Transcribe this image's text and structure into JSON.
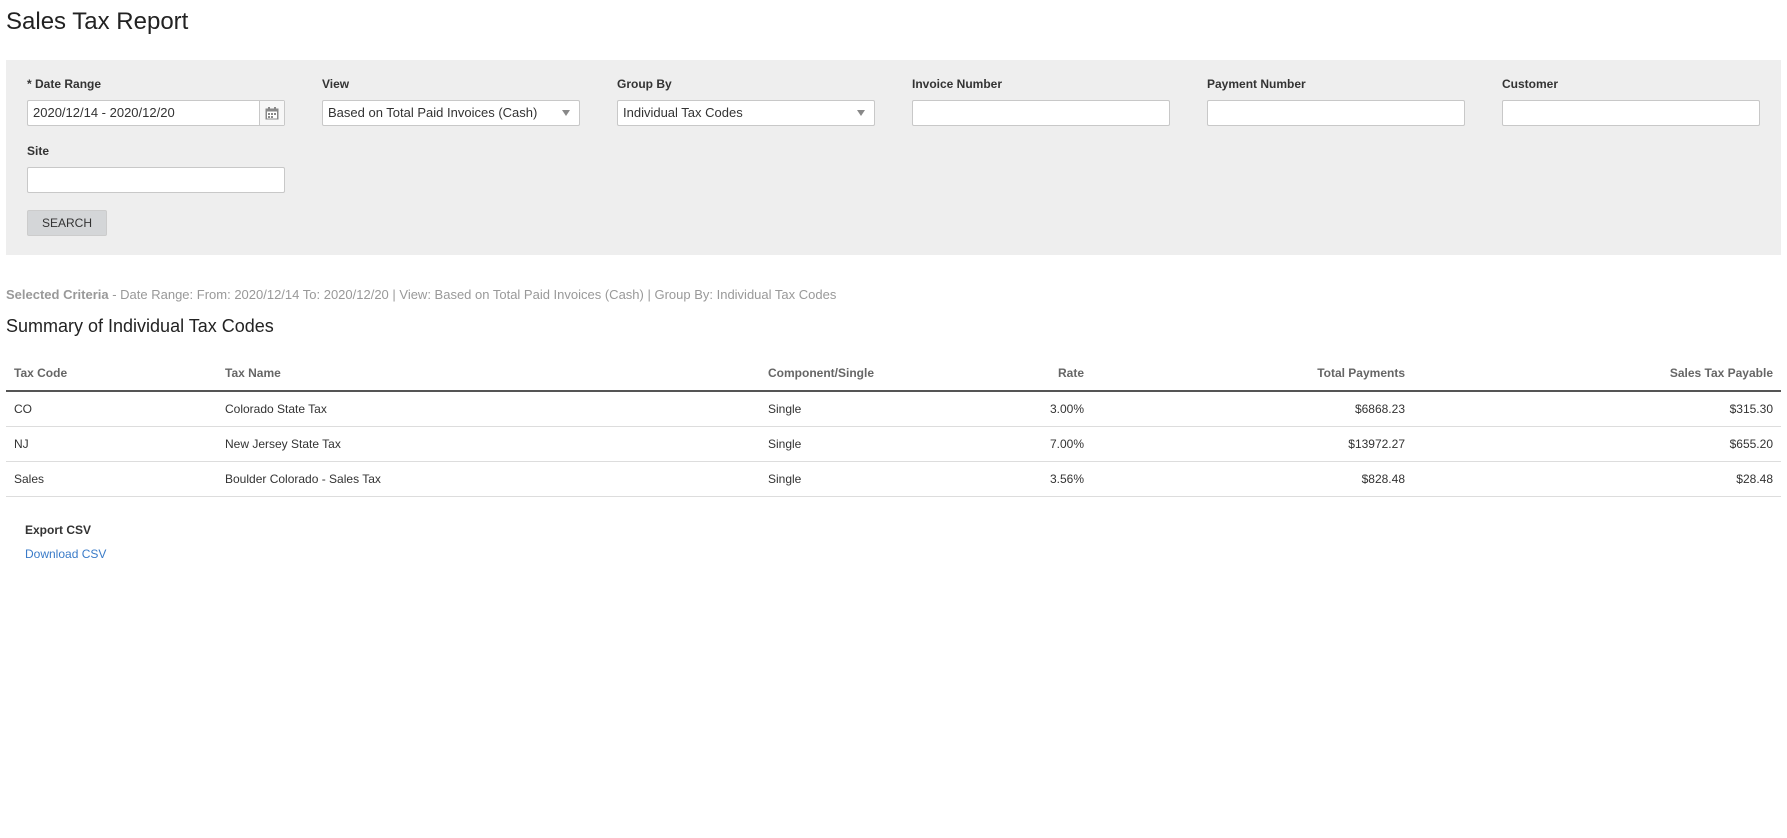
{
  "header": {
    "title": "Sales Tax Report"
  },
  "filters": {
    "date_range": {
      "label": "* Date Range",
      "value": "2020/12/14 - 2020/12/20"
    },
    "view": {
      "label": "View",
      "value": "Based on Total Paid Invoices (Cash)"
    },
    "group_by": {
      "label": "Group By",
      "value": "Individual Tax Codes"
    },
    "invoice_number": {
      "label": "Invoice Number",
      "value": ""
    },
    "payment_number": {
      "label": "Payment Number",
      "value": ""
    },
    "customer": {
      "label": "Customer",
      "value": ""
    },
    "site": {
      "label": "Site",
      "value": ""
    },
    "search_label": "SEARCH"
  },
  "criteria": {
    "label": "Selected Criteria",
    "text": " - Date Range: From: 2020/12/14 To: 2020/12/20 | View: Based on Total Paid Invoices (Cash) | Group By: Individual Tax Codes"
  },
  "summary": {
    "title": "Summary of Individual Tax Codes",
    "columns": {
      "tax_code": "Tax Code",
      "tax_name": "Tax Name",
      "component": "Component/Single",
      "rate": "Rate",
      "total_payments": "Total Payments",
      "sales_tax_payable": "Sales Tax Payable"
    },
    "rows": [
      {
        "tax_code": "CO",
        "tax_name": "Colorado State Tax",
        "component": "Single",
        "rate": "3.00%",
        "total_payments": "$6868.23",
        "sales_tax_payable": "$315.30"
      },
      {
        "tax_code": "NJ",
        "tax_name": "New Jersey State Tax",
        "component": "Single",
        "rate": "7.00%",
        "total_payments": "$13972.27",
        "sales_tax_payable": "$655.20"
      },
      {
        "tax_code": "Sales",
        "tax_name": "Boulder Colorado - Sales Tax",
        "component": "Single",
        "rate": "3.56%",
        "total_payments": "$828.48",
        "sales_tax_payable": "$28.48"
      }
    ]
  },
  "export": {
    "label": "Export CSV",
    "link": "Download CSV"
  },
  "icons": {
    "calendar": "calendar-icon",
    "dropdown": "chevron-down-icon"
  },
  "colors": {
    "panel_bg": "#eeeeee",
    "link": "#3a7bc8",
    "muted_text": "#999999"
  }
}
